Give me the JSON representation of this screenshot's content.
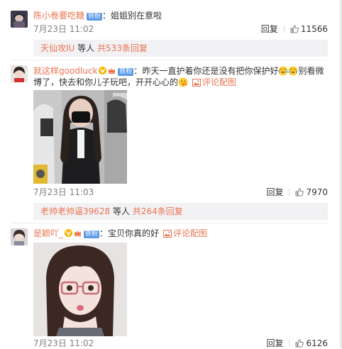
{
  "comments": [
    {
      "username": "陈小卷要吃糖",
      "badge": "铁粉",
      "separator": "：",
      "text": "姐姐别在意啦",
      "time": "7月23日 11:02",
      "reply_label": "回复",
      "likes": "11566",
      "subreplies": {
        "who": "天仙攻IU",
        "mid": " 等人 ",
        "more": "共533条回复"
      }
    },
    {
      "username": "就这样goodluck",
      "badge": "铁粉",
      "separator": "：",
      "text_line1": "昨天一直护着你还是没有把你保护好",
      "text_line1_end": "别看微",
      "text_line2": "博了，快去和你儿子玩吧，开开心心的",
      "pic_label": "评论配图",
      "time": "7月23日 11:03",
      "reply_label": "回复",
      "likes": "7970",
      "subreplies": {
        "who": "老帅老帅逼39628",
        "mid": " 等人 ",
        "more": "共264条回复"
      }
    },
    {
      "username": "是颖吖_",
      "badge": "铁粉",
      "separator": "：",
      "text": "宝贝你真的好",
      "pic_label": "评论配图",
      "time": "7月23日 11:02",
      "reply_label": "回复",
      "likes": "6126"
    }
  ],
  "icons": {
    "like": "thumbs-up-icon",
    "picture": "image-icon",
    "verified": "yellow-v-icon",
    "vip": "crown-icon"
  },
  "colors": {
    "username": "#eb7350",
    "badge": "#5a9ae8",
    "meta": "#808080",
    "subbar_bg": "#f2f2f5"
  }
}
